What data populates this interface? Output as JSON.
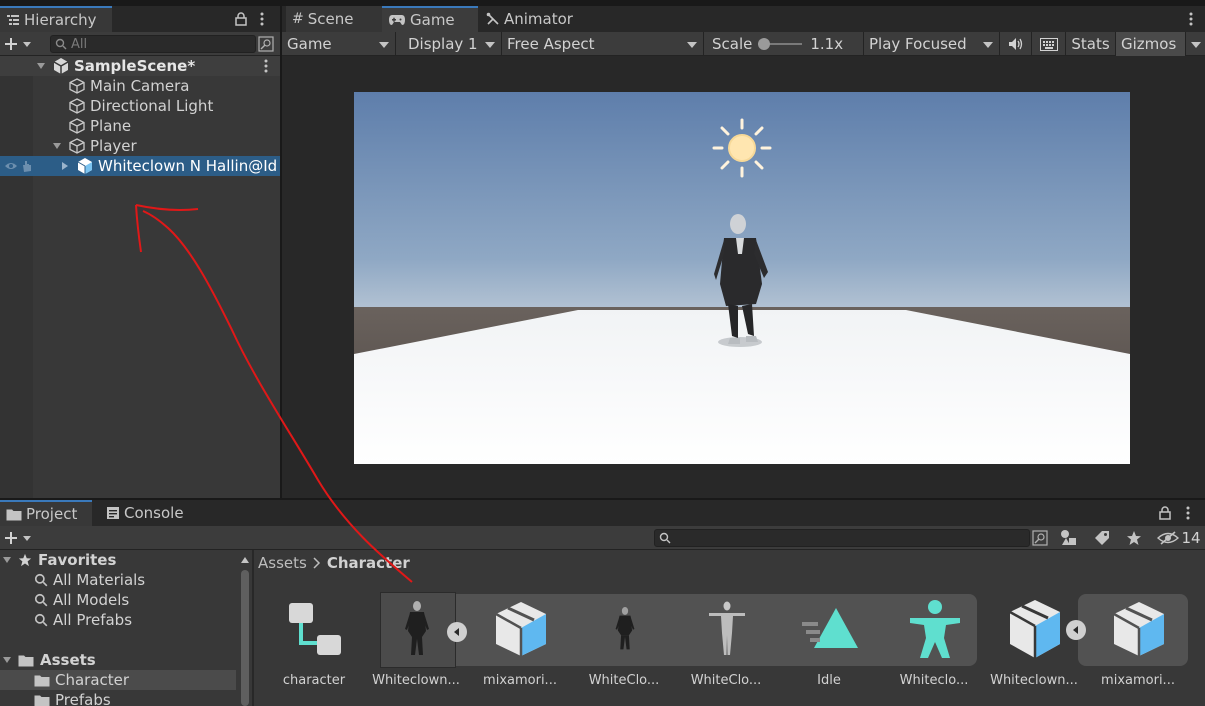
{
  "hierarchy": {
    "tab_label": "Hierarchy",
    "search_placeholder": "All",
    "scene_name": "SampleScene*",
    "items": [
      {
        "label": "Main Camera"
      },
      {
        "label": "Directional Light"
      },
      {
        "label": "Plane"
      },
      {
        "label": "Player"
      },
      {
        "label": "Whiteclown N Hallin@Id"
      }
    ]
  },
  "game_panel": {
    "tabs": [
      {
        "label": "Scene"
      },
      {
        "label": "Game"
      },
      {
        "label": "Animator"
      }
    ],
    "toolbar": {
      "view_mode": "Game",
      "display": "Display 1",
      "aspect": "Free Aspect",
      "scale_label": "Scale",
      "scale_value": "1.1x",
      "play_mode": "Play Focused",
      "stats_label": "Stats",
      "gizmos_label": "Gizmos"
    }
  },
  "project_panel": {
    "tabs": [
      {
        "label": "Project"
      },
      {
        "label": "Console"
      }
    ],
    "hidden_count": "14",
    "favorites": {
      "label": "Favorites",
      "items": [
        {
          "label": "All Materials"
        },
        {
          "label": "All Models"
        },
        {
          "label": "All Prefabs"
        }
      ]
    },
    "assets_tree": {
      "label": "Assets",
      "items": [
        {
          "label": "Character"
        },
        {
          "label": "Prefabs"
        }
      ]
    },
    "breadcrumb": {
      "root": "Assets",
      "current": "Character"
    },
    "assets": [
      {
        "label": "character",
        "icon": "animator-controller-icon"
      },
      {
        "label": "Whiteclown...",
        "icon": "model-thumbnail"
      },
      {
        "label": "mixamori...",
        "icon": "prefab-cube-icon"
      },
      {
        "label": "WhiteClo...",
        "icon": "model-thumbnail"
      },
      {
        "label": "WhiteClo...",
        "icon": "tpose-thumbnail"
      },
      {
        "label": "Idle",
        "icon": "animation-clip-icon"
      },
      {
        "label": "Whiteclo...",
        "icon": "avatar-icon"
      },
      {
        "label": "Whiteclown...",
        "icon": "prefab-cube-icon"
      },
      {
        "label": "mixamori...",
        "icon": "prefab-cube-icon"
      }
    ]
  },
  "colors": {
    "selection": "#2c5d87",
    "accent_tab": "#3a79bb",
    "annotation_red": "#e01818",
    "asset_teal": "#5fdfcf",
    "prefab_blue": "#5fb8f0"
  }
}
